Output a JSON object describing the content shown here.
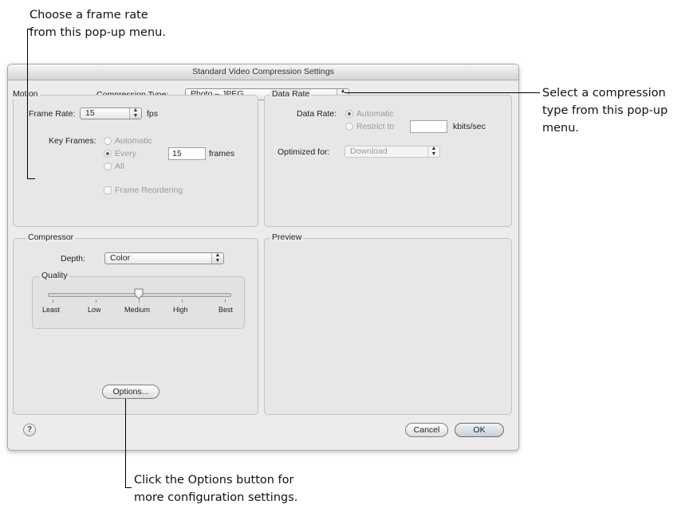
{
  "annotations": {
    "top_left": [
      "Choose a frame rate",
      "from this pop-up menu."
    ],
    "right": [
      "Select a compression",
      "type from this pop-up",
      "menu."
    ],
    "bottom": [
      "Click the Options button for",
      "more configuration settings."
    ]
  },
  "dialog": {
    "title": "Standard Video Compression Settings",
    "compression_type_label": "Compression Type:",
    "compression_type_value": "Photo – JPEG",
    "motion": {
      "title": "Motion",
      "frame_rate_label": "Frame Rate:",
      "frame_rate_value": "15",
      "fps_label": "fps",
      "key_frames_label": "Key Frames:",
      "automatic_label": "Automatic",
      "every_label": "Every",
      "every_value": "15",
      "frames_label": "frames",
      "all_label": "All",
      "frame_reordering_label": "Frame Reordering",
      "key_frames_selected": "Every"
    },
    "data_rate": {
      "title": "Data Rate",
      "data_rate_label": "Data Rate:",
      "automatic_label": "Automatic",
      "restrict_label": "Restrict to",
      "restrict_value": "",
      "unit_label": "kbits/sec",
      "optimized_label": "Optimized for:",
      "optimized_value": "Download",
      "selected": "Automatic"
    },
    "compressor": {
      "title": "Compressor",
      "depth_label": "Depth:",
      "depth_value": "Color",
      "quality_title": "Quality",
      "quality_ticks": [
        "Least",
        "Low",
        "Medium",
        "High",
        "Best"
      ],
      "quality_level": "Medium",
      "options_button": "Options..."
    },
    "preview": {
      "title": "Preview"
    },
    "help_button": "?",
    "cancel_button": "Cancel",
    "ok_button": "OK"
  }
}
